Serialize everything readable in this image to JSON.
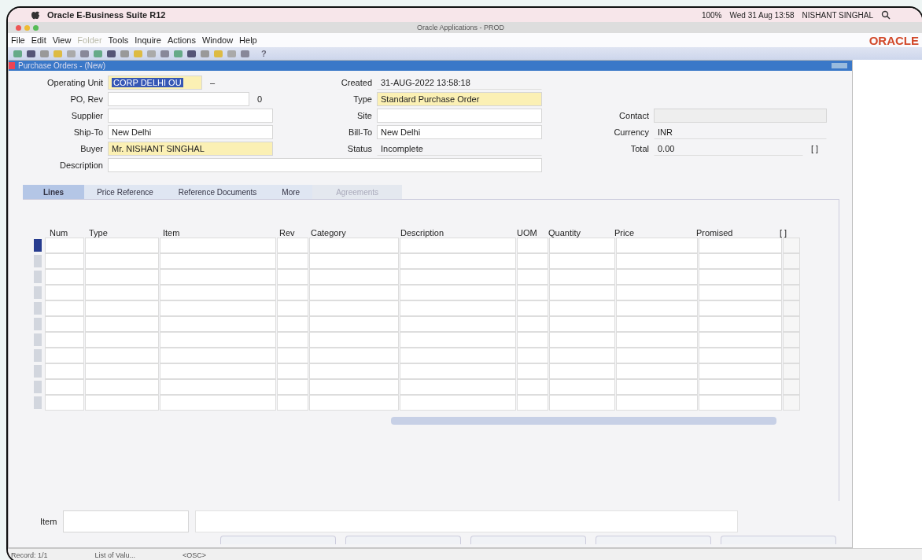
{
  "mac_menubar": {
    "app": "Oracle E-Business Suite R12",
    "status": [
      "100%",
      "Wed 31 Aug 13:58",
      "NISHANT SINGHAL"
    ]
  },
  "window": {
    "title": "Oracle Applications - PROD"
  },
  "menu": [
    {
      "label": "File",
      "disabled": false
    },
    {
      "label": "Edit",
      "disabled": false
    },
    {
      "label": "View",
      "disabled": false
    },
    {
      "label": "Folder",
      "disabled": true
    },
    {
      "label": "Tools",
      "disabled": false
    },
    {
      "label": "Inquire",
      "disabled": false
    },
    {
      "label": "Actions",
      "disabled": false
    },
    {
      "label": "Window",
      "disabled": false
    },
    {
      "label": "Help",
      "disabled": false
    }
  ],
  "logo": "ORACLE",
  "toolbar": {
    "help": "?"
  },
  "form": {
    "title": "Purchase Orders - (New)",
    "rows": [
      {
        "left": {
          "label": "Operating Unit",
          "value": "CORP DELHI OU",
          "kind": "selected",
          "suffix": "–"
        },
        "middle": {
          "label": "Created",
          "value": "31-AUG-2022 13:58:18",
          "kind": "readonly"
        }
      },
      {
        "left": {
          "label": "PO, Rev",
          "kind": "text",
          "suffix": "0"
        },
        "middle": {
          "label": "Type",
          "value": "Standard Purchase Order",
          "kind": "required"
        }
      },
      {
        "left": {
          "label": "Supplier",
          "kind": "text"
        },
        "middle": {
          "label": "Site",
          "kind": "text"
        },
        "right": {
          "label": "Contact",
          "kind": "disabled"
        }
      },
      {
        "left": {
          "label": "Ship-To",
          "value": "New Delhi",
          "kind": "text"
        },
        "middle": {
          "label": "Bill-To",
          "value": "New Delhi",
          "kind": "text"
        },
        "right": {
          "label": "Currency",
          "value": "INR",
          "kind": "readonly"
        }
      },
      {
        "left": {
          "label": "Buyer",
          "value": "Mr. NISHANT SINGHAL",
          "kind": "required"
        },
        "middle": {
          "label": "Status",
          "value": "Incomplete",
          "kind": "readonly"
        },
        "right": {
          "label": "Total",
          "value": "0.00",
          "kind": "readonly",
          "suffix": "[ ]"
        }
      }
    ],
    "description": {
      "label": "Description"
    },
    "tabs": [
      {
        "label": "Lines",
        "selected": true,
        "disabled": false
      },
      {
        "label": "Price Reference",
        "selected": false,
        "disabled": false
      },
      {
        "label": "Reference Documents",
        "selected": false,
        "disabled": false
      },
      {
        "label": "More",
        "selected": false,
        "disabled": false
      },
      {
        "label": "Agreements",
        "selected": false,
        "disabled": true
      }
    ],
    "table": {
      "columns": [
        "Num",
        "Type",
        "Item",
        "Rev",
        "Category",
        "Description",
        "UOM",
        "Quantity",
        "Price",
        "Promised"
      ],
      "folder_mark": "[ ]",
      "rows": [
        {
          "selected": true
        },
        {
          "selected": false
        },
        {
          "selected": false
        },
        {
          "selected": false
        },
        {
          "selected": false
        },
        {
          "selected": false
        },
        {
          "selected": false
        },
        {
          "selected": false
        },
        {
          "selected": false
        },
        {
          "selected": false
        },
        {
          "selected": false
        }
      ]
    },
    "item": {
      "label": "Item"
    }
  },
  "status_bar": [
    "Record: 1/1",
    "List of Valu...",
    "<OSC>"
  ]
}
